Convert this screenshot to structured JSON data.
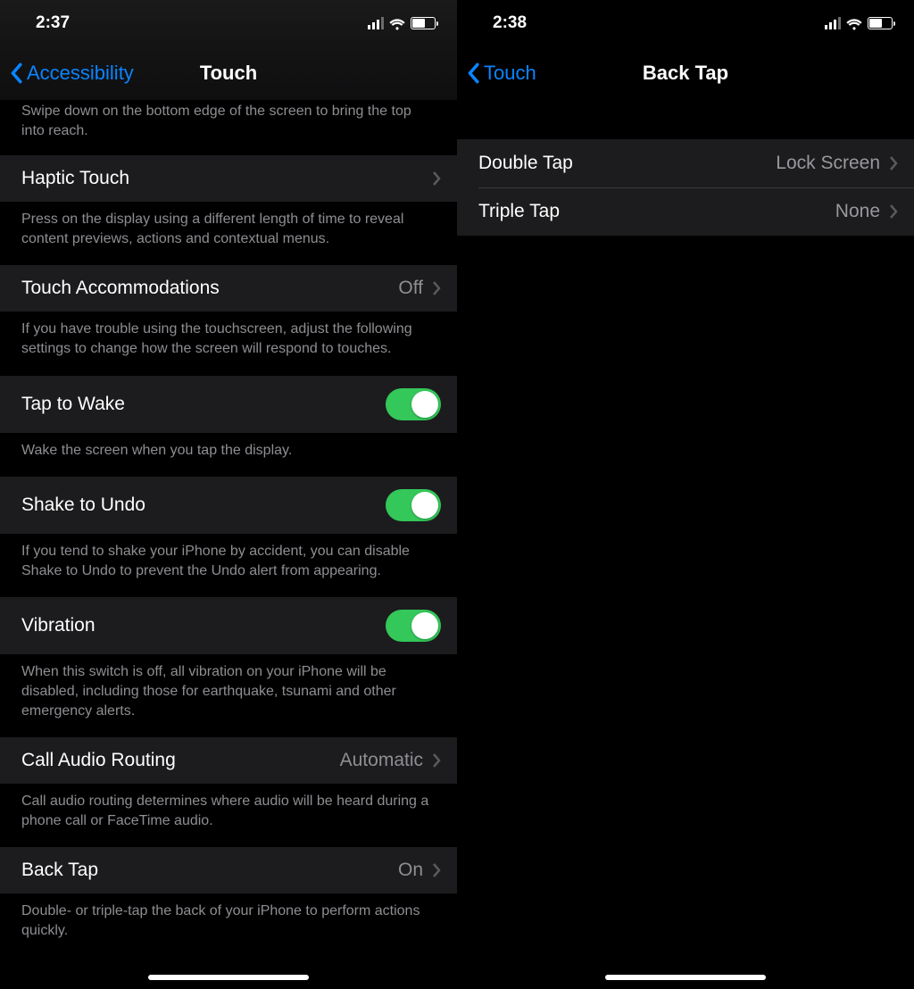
{
  "left": {
    "status": {
      "time": "2:37"
    },
    "nav": {
      "back": "Accessibility",
      "title": "Touch"
    },
    "reachabilityFooter": "Swipe down on the bottom edge of the screen to bring the top into reach.",
    "hapticTouch": {
      "label": "Haptic Touch"
    },
    "hapticTouchFooter": "Press on the display using a different length of time to reveal content previews, actions and contextual menus.",
    "touchAccommodations": {
      "label": "Touch Accommodations",
      "value": "Off"
    },
    "touchAccommodationsFooter": "If you have trouble using the touchscreen, adjust the following settings to change how the screen will respond to touches.",
    "tapToWake": {
      "label": "Tap to Wake"
    },
    "tapToWakeFooter": "Wake the screen when you tap the display.",
    "shakeToUndo": {
      "label": "Shake to Undo"
    },
    "shakeToUndoFooter": "If you tend to shake your iPhone by accident, you can disable Shake to Undo to prevent the Undo alert from appearing.",
    "vibration": {
      "label": "Vibration"
    },
    "vibrationFooter": "When this switch is off, all vibration on your iPhone will be disabled, including those for earthquake, tsunami and other emergency alerts.",
    "callAudioRouting": {
      "label": "Call Audio Routing",
      "value": "Automatic"
    },
    "callAudioRoutingFooter": "Call audio routing determines where audio will be heard during a phone call or FaceTime audio.",
    "backTap": {
      "label": "Back Tap",
      "value": "On"
    },
    "backTapFooter": "Double- or triple-tap the back of your iPhone to perform actions quickly."
  },
  "right": {
    "status": {
      "time": "2:38"
    },
    "nav": {
      "back": "Touch",
      "title": "Back Tap"
    },
    "doubleTap": {
      "label": "Double Tap",
      "value": "Lock Screen"
    },
    "tripleTap": {
      "label": "Triple Tap",
      "value": "None"
    }
  }
}
